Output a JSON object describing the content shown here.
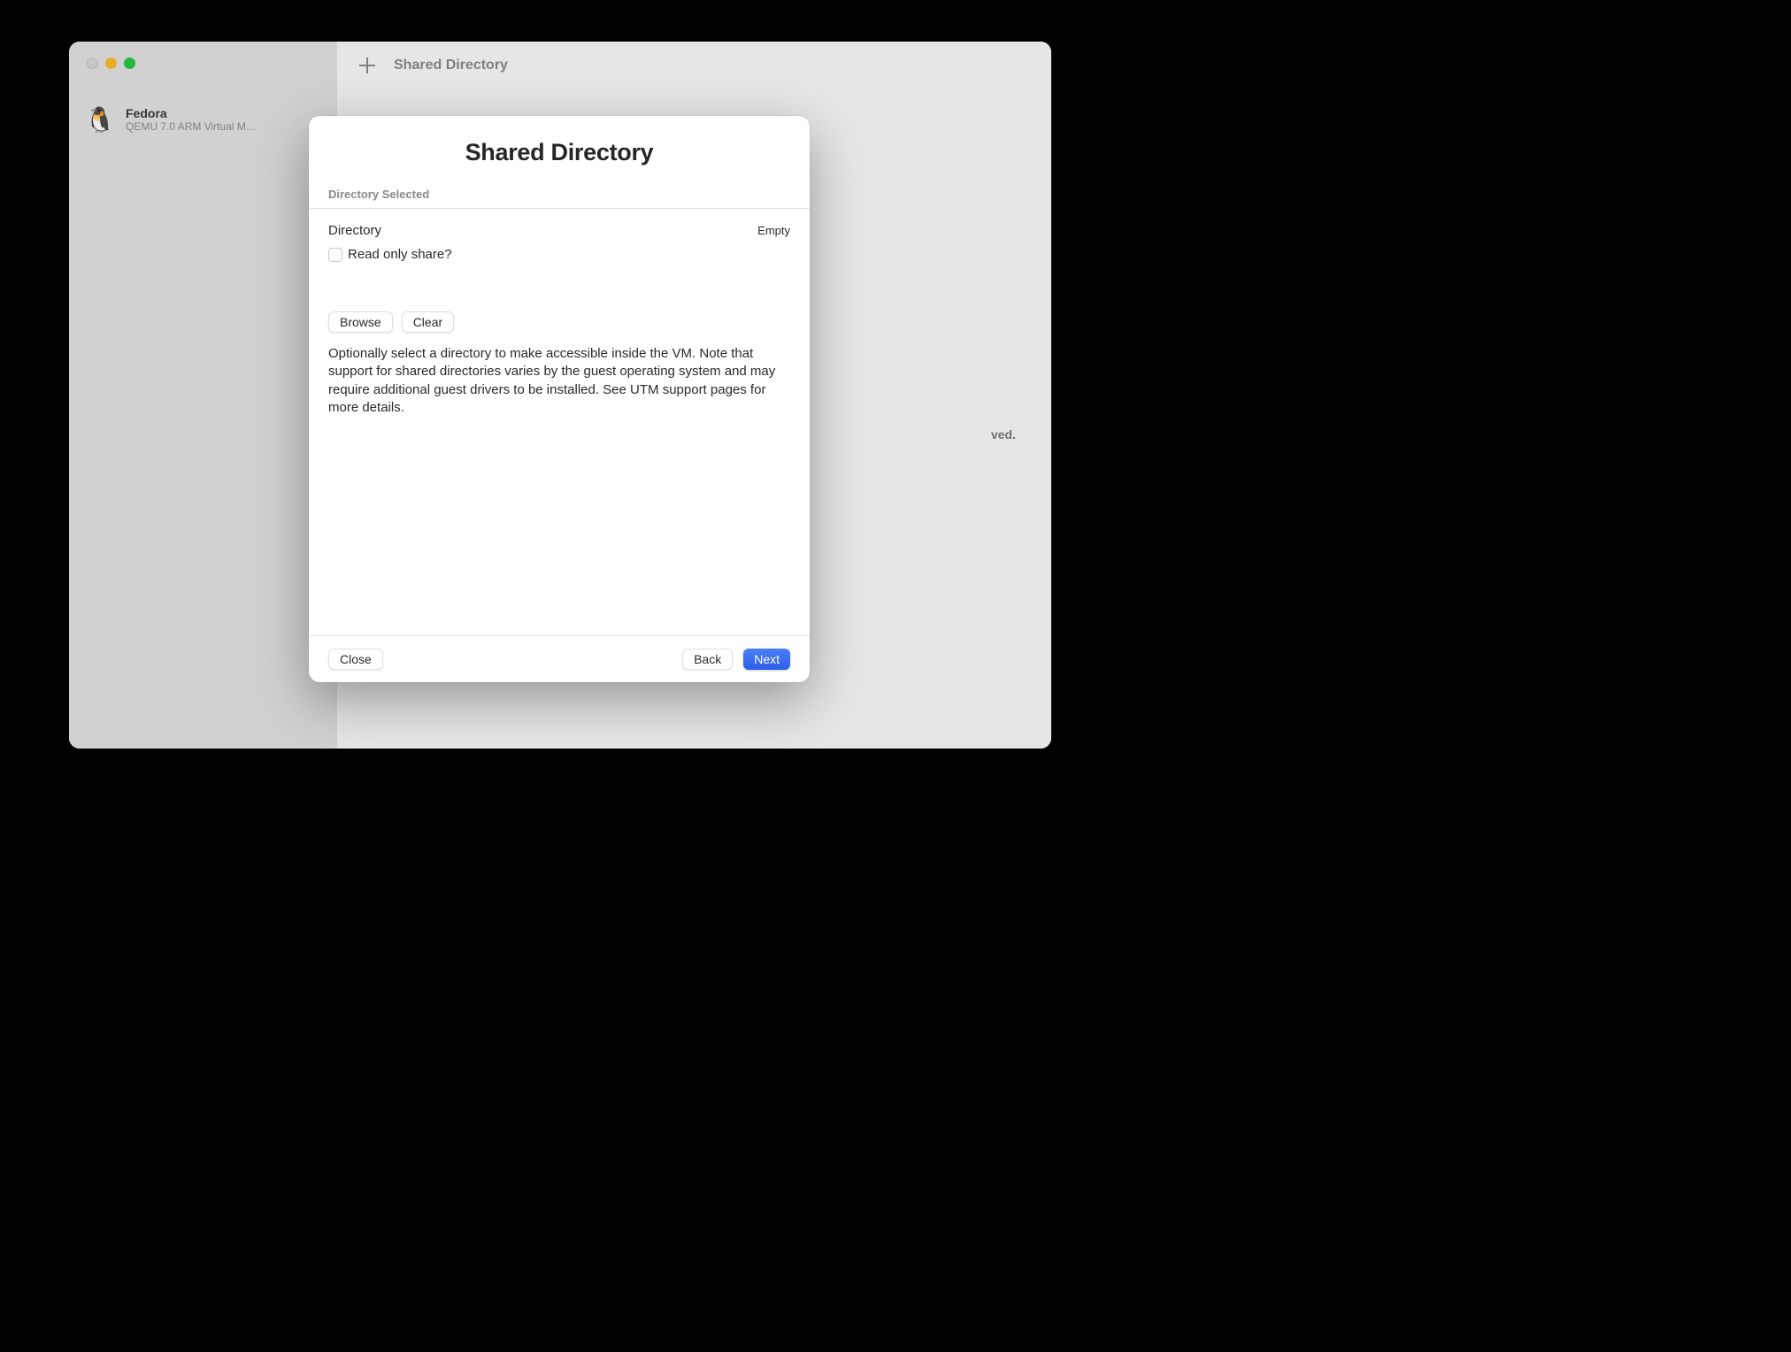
{
  "sidebar": {
    "vm": {
      "name": "Fedora",
      "subtitle": "QEMU 7.0 ARM Virtual M…",
      "icon_emoji": "🐧"
    }
  },
  "toolbar": {
    "title": "Shared Directory"
  },
  "background": {
    "partial_text": "ved."
  },
  "modal": {
    "title": "Shared Directory",
    "section_header": "Directory Selected",
    "directory": {
      "label": "Directory",
      "value": "Empty"
    },
    "checkbox": {
      "label": "Read only share?"
    },
    "buttons": {
      "browse": "Browse",
      "clear": "Clear"
    },
    "help_text": "Optionally select a directory to make accessible inside the VM. Note that support for shared directories varies by the guest operating system and may require additional guest drivers to be installed. See UTM support pages for more details.",
    "footer": {
      "close": "Close",
      "back": "Back",
      "next": "Next"
    }
  }
}
